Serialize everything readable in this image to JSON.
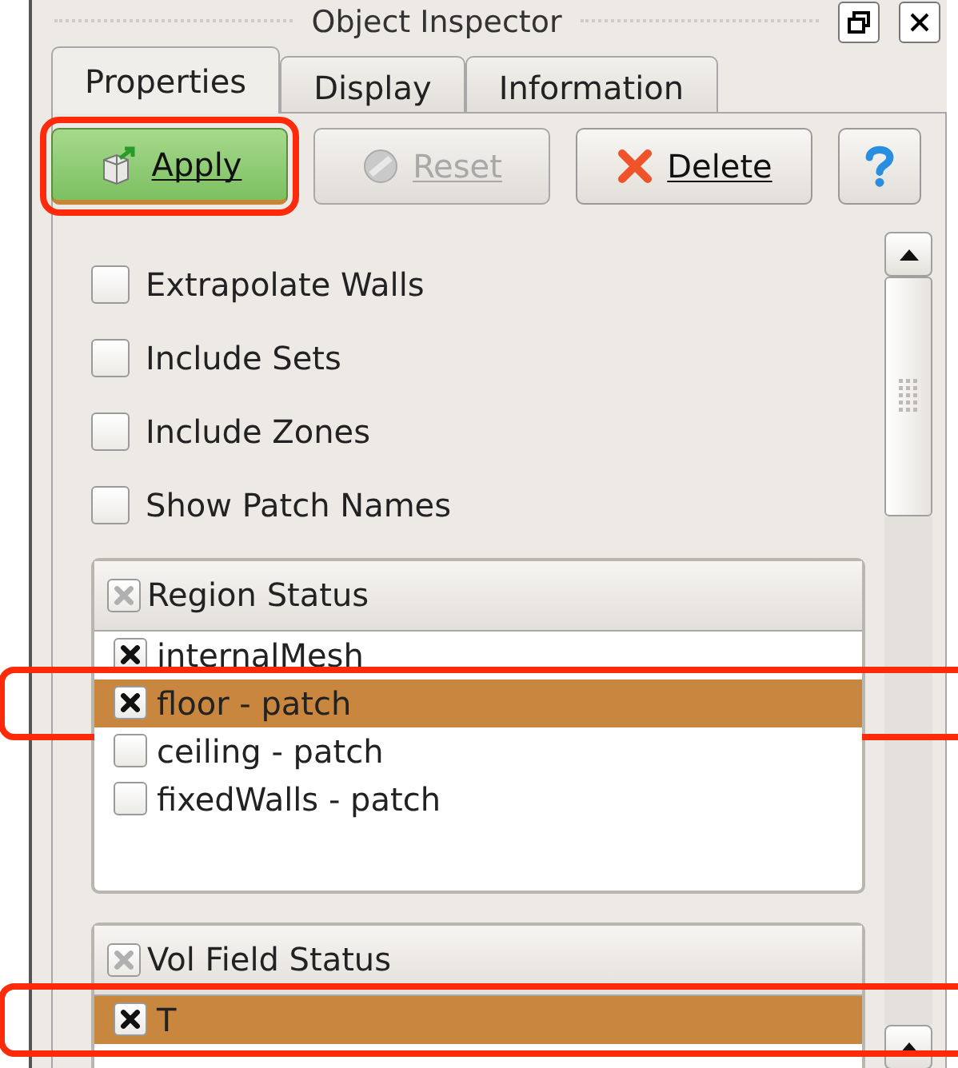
{
  "title": "Object Inspector",
  "tabs": [
    {
      "label": "Properties",
      "selected": true
    },
    {
      "label": "Display",
      "selected": false
    },
    {
      "label": "Information",
      "selected": false
    }
  ],
  "buttons": [
    {
      "kind": "apply",
      "label": "Apply",
      "disabled": false,
      "highlighted": true
    },
    {
      "kind": "reset",
      "label": "Reset",
      "disabled": true,
      "highlighted": false
    },
    {
      "kind": "delete",
      "label": "Delete",
      "disabled": false,
      "highlighted": false
    },
    {
      "kind": "help",
      "disabled": false,
      "highlighted": false
    }
  ],
  "options": [
    {
      "label": "Extrapolate Walls",
      "checked": false
    },
    {
      "label": "Include Sets",
      "checked": false
    },
    {
      "label": "Include Zones",
      "checked": false
    },
    {
      "label": "Show Patch Names",
      "checked": false
    }
  ],
  "groups": [
    {
      "title": "Region Status",
      "header_partial": true,
      "rows": [
        {
          "label": "internalMesh",
          "checked": true,
          "selected": false,
          "highlighted": false
        },
        {
          "label": "floor - patch",
          "checked": true,
          "selected": true,
          "highlighted": true
        },
        {
          "label": "ceiling - patch",
          "checked": false,
          "selected": false,
          "highlighted": false
        },
        {
          "label": "fixedWalls - patch",
          "checked": false,
          "selected": false,
          "highlighted": false
        }
      ]
    },
    {
      "title": "Vol Field Status",
      "header_partial": true,
      "rows": [
        {
          "label": "T",
          "checked": true,
          "selected": true,
          "highlighted": true
        }
      ]
    }
  ]
}
